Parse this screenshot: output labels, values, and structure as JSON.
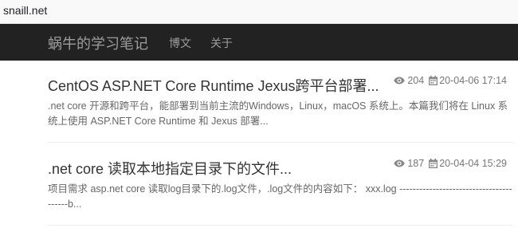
{
  "browser": {
    "url": "snaill.net"
  },
  "navbar": {
    "brand": "蜗牛的学习笔记",
    "links": [
      "博文",
      "关于"
    ]
  },
  "posts": [
    {
      "title": "CentOS ASP.NET Core Runtime Jexus跨平台部署...",
      "views": "204",
      "date": "20-04-06 17:14",
      "summary": ".net core 开源和跨平台，能部署到当前主流的Windows，Linux，macOS 系统上。本篇我们将在 Linux 系统上使用 ASP.NET Core Runtime 和 Jexus 部署..."
    },
    {
      "title": ".net core 读取本地指定目录下的文件...",
      "views": "187",
      "date": "20-04-04 15:29",
      "summary": "项目需求 asp.net core 读取log目录下的.log文件，.log文件的内容如下： xxx.log ----------------------------------------b..."
    }
  ],
  "icons": {
    "views": "eye-icon",
    "date": "calendar-icon"
  },
  "colors": {
    "navbar_bg": "#222222",
    "nav_text": "#9d9d9d",
    "title": "#333333",
    "muted": "#777777"
  }
}
